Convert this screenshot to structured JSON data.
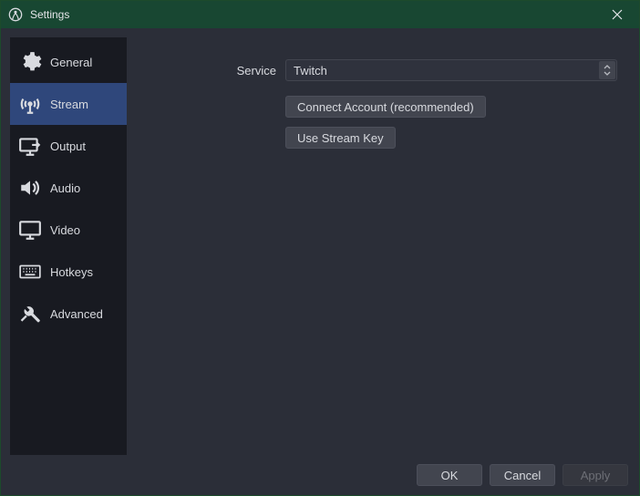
{
  "window": {
    "title": "Settings"
  },
  "sidebar": {
    "items": [
      {
        "label": "General"
      },
      {
        "label": "Stream"
      },
      {
        "label": "Output"
      },
      {
        "label": "Audio"
      },
      {
        "label": "Video"
      },
      {
        "label": "Hotkeys"
      },
      {
        "label": "Advanced"
      }
    ],
    "active_index": 1
  },
  "form": {
    "service_label": "Service",
    "service_value": "Twitch",
    "connect_button": "Connect Account (recommended)",
    "use_key_button": "Use Stream Key"
  },
  "footer": {
    "ok": "OK",
    "cancel": "Cancel",
    "apply": "Apply"
  }
}
